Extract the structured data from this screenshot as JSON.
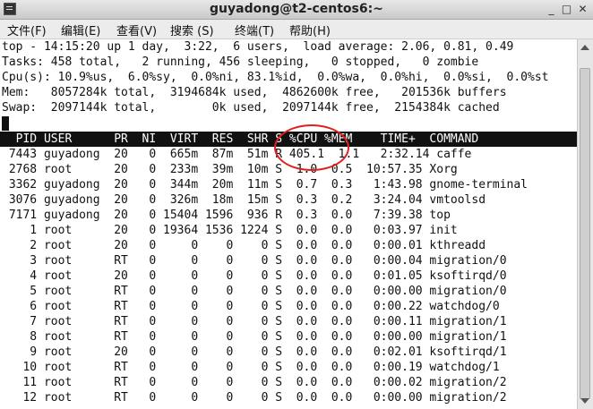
{
  "window": {
    "title": "guyadong@t2-centos6:~",
    "minimize_label": "_",
    "maximize_label": "□",
    "close_label": "✕"
  },
  "menu": [
    "文件(F)",
    "编辑(E)",
    "查看(V)",
    "搜索 (S)",
    "终端(T)",
    "帮助(H)"
  ],
  "summary": {
    "top": "top - 14:15:20 up 1 day,  3:22,  6 users,  load average: 2.06, 0.81, 0.49",
    "tasks": "Tasks: 458 total,   2 running, 456 sleeping,   0 stopped,   0 zombie",
    "cpu": "Cpu(s): 10.9%us,  6.0%sy,  0.0%ni, 83.1%id,  0.0%wa,  0.0%hi,  0.0%si,  0.0%st",
    "mem": "Mem:   8057284k total,  3194684k used,  4862600k free,   201536k buffers",
    "swap": "Swap:  2097144k total,        0k used,  2097144k free,  2154384k cached"
  },
  "table": {
    "header": "  PID USER      PR  NI  VIRT  RES  SHR S %CPU %MEM    TIME+  COMMAND",
    "rows": [
      " 7443 guyadong  20   0  665m  87m  51m R 405.1  1.1   2:32.14 caffe",
      " 2768 root      20   0  233m  39m  10m S  1.0  0.5  10:57.35 Xorg",
      " 3362 guyadong  20   0  344m  20m  11m S  0.7  0.3   1:43.98 gnome-terminal",
      " 3076 guyadong  20   0  326m  18m  15m S  0.3  0.2   3:24.04 vmtoolsd",
      " 7171 guyadong  20   0 15404 1596  936 R  0.3  0.0   7:39.38 top",
      "    1 root      20   0 19364 1536 1224 S  0.0  0.0   0:03.97 init",
      "    2 root      20   0     0    0    0 S  0.0  0.0   0:00.01 kthreadd",
      "    3 root      RT   0     0    0    0 S  0.0  0.0   0:00.04 migration/0",
      "    4 root      20   0     0    0    0 S  0.0  0.0   0:01.05 ksoftirqd/0",
      "    5 root      RT   0     0    0    0 S  0.0  0.0   0:00.00 migration/0",
      "    6 root      RT   0     0    0    0 S  0.0  0.0   0:00.22 watchdog/0",
      "    7 root      RT   0     0    0    0 S  0.0  0.0   0:00.11 migration/1",
      "    8 root      RT   0     0    0    0 S  0.0  0.0   0:00.00 migration/1",
      "    9 root      20   0     0    0    0 S  0.0  0.0   0:02.01 ksoftirqd/1",
      "   10 root      RT   0     0    0    0 S  0.0  0.0   0:00.19 watchdog/1",
      "   11 root      RT   0     0    0    0 S  0.0  0.0   0:00.02 migration/2",
      "   12 root      RT   0     0    0    0 S  0.0  0.0   0:00.00 migration/2"
    ]
  },
  "colors": {
    "annotation": "#e02020",
    "header_bg": "#111111",
    "header_fg": "#ffffff"
  }
}
